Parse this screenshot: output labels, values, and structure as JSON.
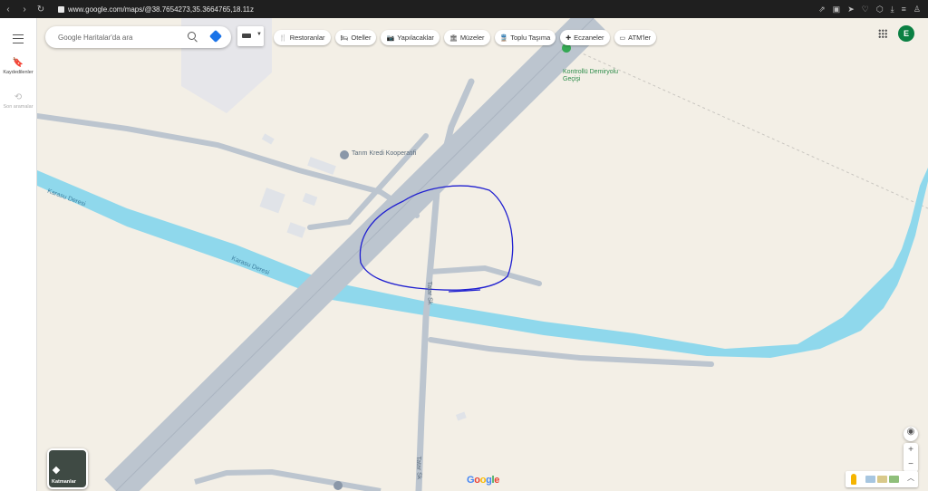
{
  "browser": {
    "url": "www.google.com/maps/@38.7654273,35.3664765,18.11z"
  },
  "sidebar": {
    "saved_label": "Kaydedilenler",
    "recent_label": "Son aramalar"
  },
  "search": {
    "placeholder": "Google Haritalar'da ara"
  },
  "chips": [
    {
      "label": "Restoranlar",
      "icon": "fork-knife-icon"
    },
    {
      "label": "Oteller",
      "icon": "bed-icon"
    },
    {
      "label": "Yapılacaklar",
      "icon": "camera-icon"
    },
    {
      "label": "Müzeler",
      "icon": "museum-icon"
    },
    {
      "label": "Toplu Taşıma",
      "icon": "train-icon"
    },
    {
      "label": "Eczaneler",
      "icon": "pharmacy-icon"
    },
    {
      "label": "ATM'ler",
      "icon": "atm-icon"
    }
  ],
  "account": {
    "initial": "E",
    "color": "#0b8043"
  },
  "map": {
    "labels": {
      "river1": "Karasu Deresi",
      "river2": "Karasu Deresi",
      "poi": "Tarım Kredi Kooperatifi",
      "rail_crossing": "Kontrollü Demiryolu Geçişi",
      "street1": "Tatar Sk",
      "street2": "Tatar Sk"
    },
    "colors": {
      "land": "#f3efe6",
      "water": "#8fd8ec",
      "road": "#bcc5cf",
      "annotation": "#2020d0"
    }
  },
  "layers_button": {
    "label": "Katmanlar"
  },
  "logo": "Google",
  "controls": {
    "zoom_in": "+",
    "zoom_out": "−"
  }
}
